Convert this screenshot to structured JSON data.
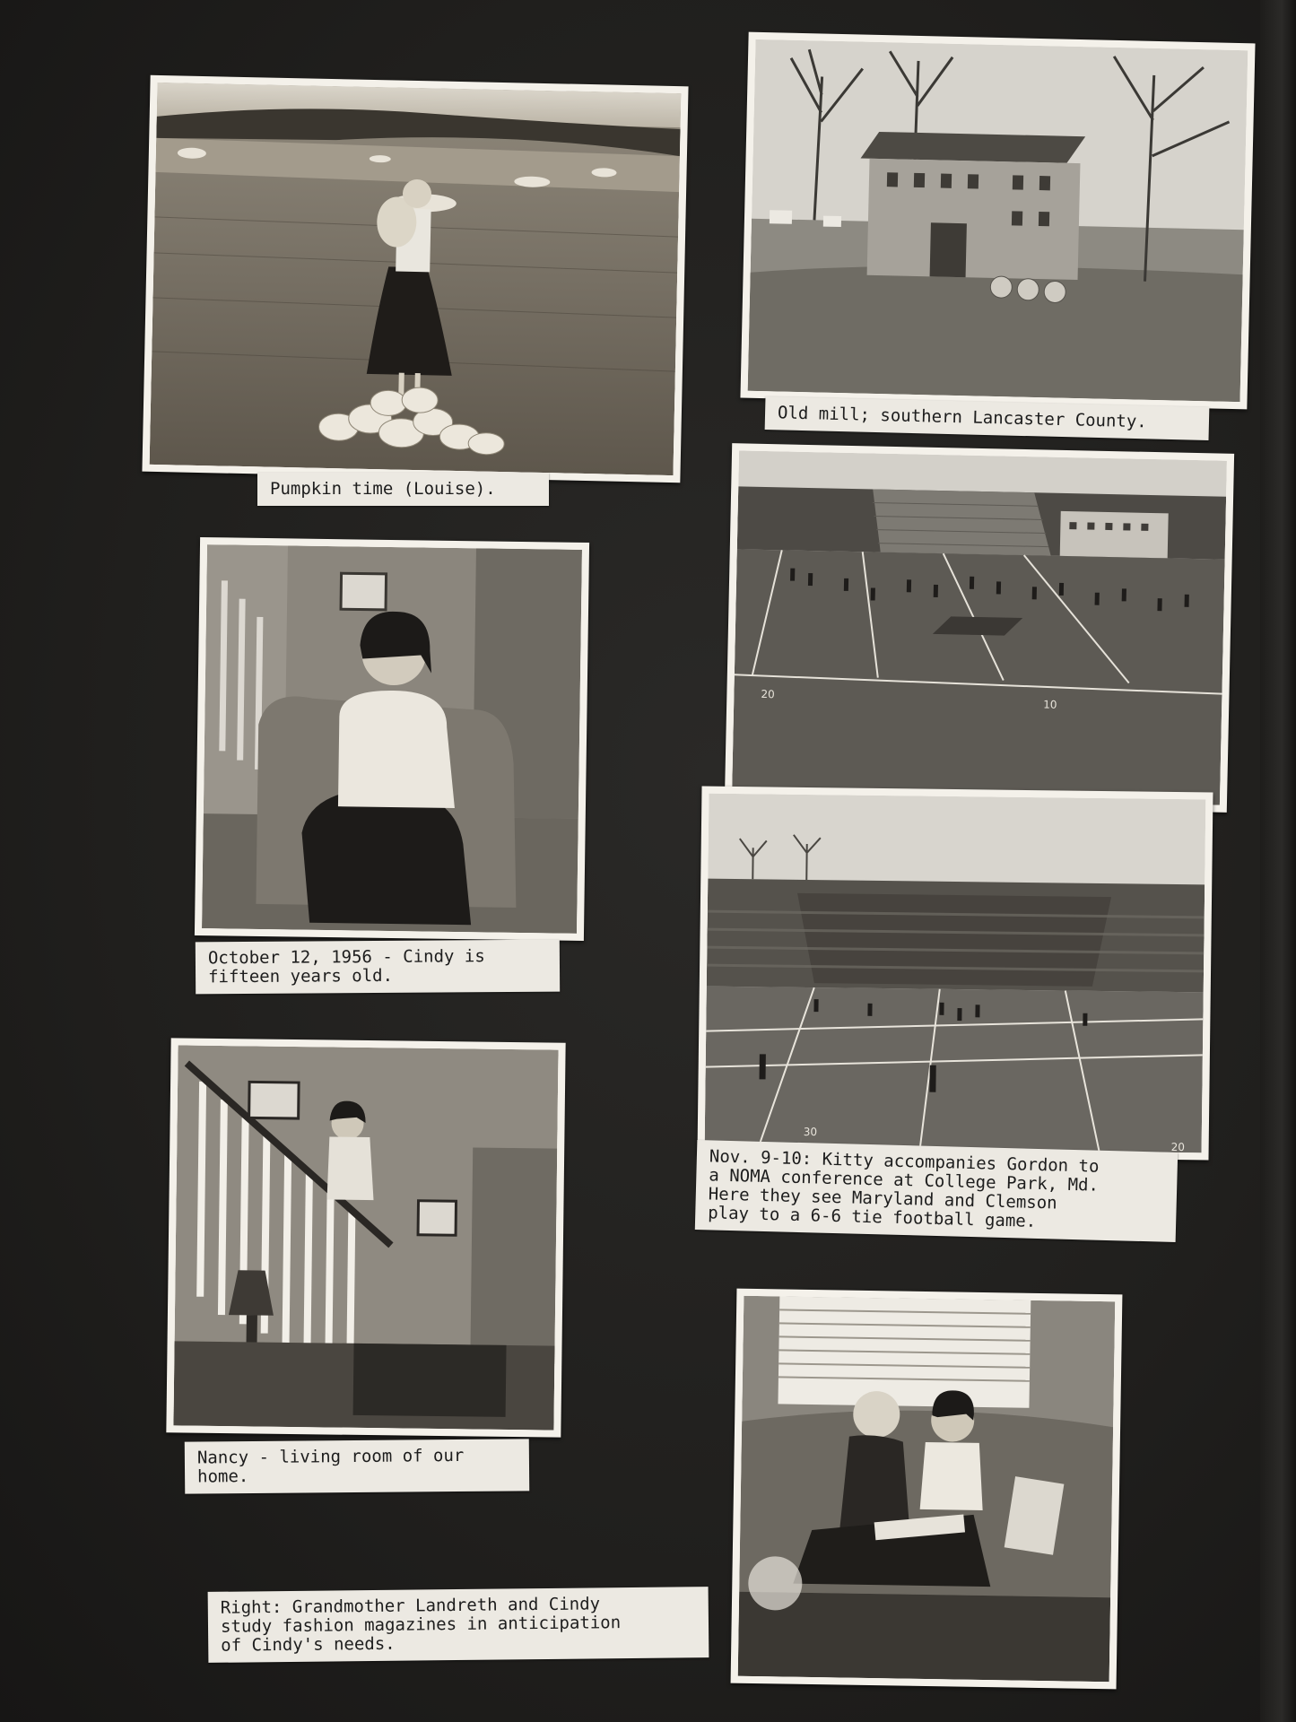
{
  "captions": {
    "pumpkin": "Pumpkin time (Louise).",
    "mill": "Old mill; southern Lancaster County.",
    "cindy": "October 12, 1956 - Cindy is\nfifteen years old.",
    "nancy": "Nancy - living room of our\nhome.",
    "football": "Nov. 9-10: Kitty accompanies Gordon to\na NOMA conference at College Park, Md.\nHere they see Maryland and Clemson\nplay to a 6-6 tie football game.",
    "grandmother": "Right: Grandmother Landreth and Cindy\nstudy fashion magazines in anticipation\nof Cindy's needs."
  },
  "field_numbers": {
    "band_left": "20",
    "band_right": "10",
    "game_left": "30",
    "game_right": "20"
  },
  "colors": {
    "album_page": "#201f1d",
    "photo_border": "#f4f1ea",
    "caption_paper": "#ece9e2"
  }
}
